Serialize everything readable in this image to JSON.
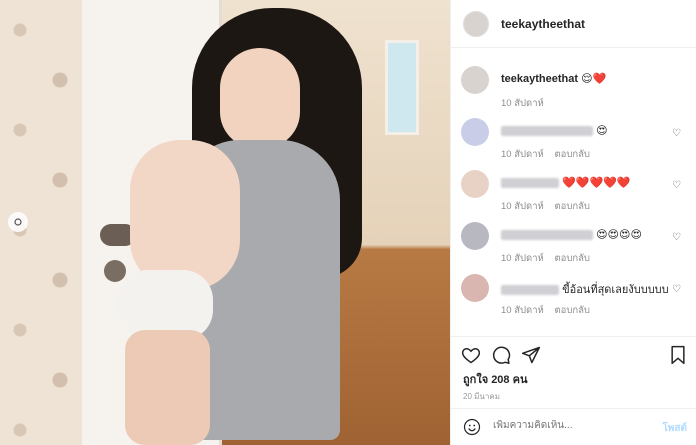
{
  "post": {
    "username": "teekaytheethat",
    "caption_username": "teekaytheethat",
    "caption_emojis": "😌❤️",
    "caption_time": "10 สัปดาห์",
    "likes": "ถูกใจ 208 คน",
    "date": "20 มีนาคม"
  },
  "comments": [
    {
      "text": "😍",
      "time": "10 สัปดาห์",
      "reply": "ตอบกลับ",
      "avatar_color": "#c9cde8"
    },
    {
      "text": "❤️❤️❤️❤️❤️",
      "time": "10 สัปดาห์",
      "reply": "ตอบกลับ",
      "avatar_color": "#e8d2c6"
    },
    {
      "text": "😍😍😍😍",
      "time": "10 สัปดาห์",
      "reply": "ตอบกลับ",
      "avatar_color": "#b8b8c0"
    },
    {
      "text": "ขี้อ้อนที่สุดเลยงับบบบบ",
      "time": "10 สัปดาห์",
      "reply": "ตอบกลับ",
      "avatar_color": "#d9b6b0"
    }
  ],
  "add_comment": {
    "placeholder": "เพิ่มความคิดเห็น...",
    "post_label": "โพสต์"
  },
  "icons": {
    "like": "heart-outline-icon",
    "comment": "comment-bubble-icon",
    "share": "paper-plane-icon",
    "save": "bookmark-icon",
    "emoji": "smiley-icon"
  },
  "colors": {
    "heart": "#ed4956",
    "post_button": "#b3dbff",
    "meta_text": "#8e8e8e"
  }
}
